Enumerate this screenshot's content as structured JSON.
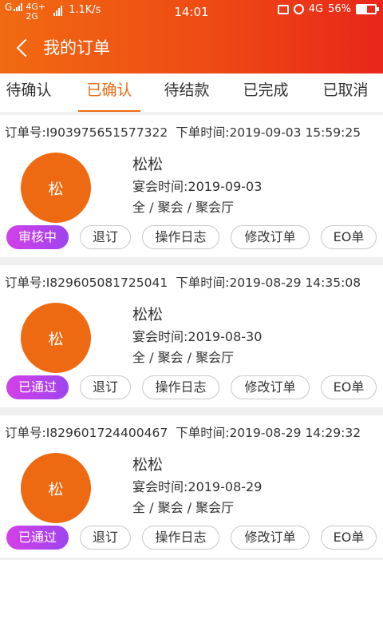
{
  "status_bar": {
    "network": "G",
    "network2_top": "4G+",
    "network2_bottom": "2G",
    "speed": "1.1K/s",
    "time": "14:01",
    "lte": "4G",
    "battery": "56%",
    "battery_level": 0.56
  },
  "header": {
    "back_icon": "chevron-left-icon",
    "title": "我的订单",
    "gradient": [
      "#f06a12",
      "#e8261a"
    ]
  },
  "tabs": [
    {
      "label": "待确认"
    },
    {
      "label": "已确认"
    },
    {
      "label": "待结款"
    },
    {
      "label": "已完成"
    },
    {
      "label": "已取消"
    }
  ],
  "active_tab": "已确认",
  "accent_color": "#ee6a16",
  "orders": [
    {
      "order_no": "订单号:I903975651577322",
      "order_time": "下单时间:2019-09-03 15:59:25",
      "avatar": "松",
      "name": "松松",
      "feast_time": "宴会时间:2019-09-03",
      "venue": "全 / 聚会 / 聚会厅",
      "status": "审核中",
      "actions": [
        "退订",
        "操作日志",
        "修改订单",
        "EO单"
      ]
    },
    {
      "order_no": "订单号:I829605081725041",
      "order_time": "下单时间:2019-08-29 14:35:08",
      "avatar": "松",
      "name": "松松",
      "feast_time": "宴会时间:2019-08-30",
      "venue": "全 / 聚会 / 聚会厅",
      "status": "已通过",
      "actions": [
        "退订",
        "操作日志",
        "修改订单",
        "EO单"
      ]
    },
    {
      "order_no": "订单号:I829601724400467",
      "order_time": "下单时间:2019-08-29 14:29:32",
      "avatar": "松",
      "name": "松松",
      "feast_time": "宴会时间:2019-08-29",
      "venue": "全 / 聚会 / 聚会厅",
      "status": "已通过",
      "actions": [
        "退订",
        "操作日志",
        "修改订单",
        "EO单"
      ]
    }
  ]
}
